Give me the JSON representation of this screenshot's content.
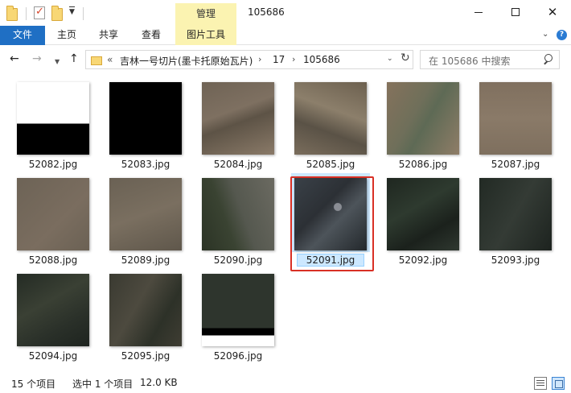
{
  "window": {
    "title": "105686",
    "contextual_tab": "管理"
  },
  "ribbon": {
    "file_tab": "文件",
    "tabs": [
      {
        "label": "主页"
      },
      {
        "label": "共享"
      },
      {
        "label": "查看"
      },
      {
        "label": "图片工具"
      }
    ],
    "active_tab_index": 3
  },
  "address": {
    "overflow": "«",
    "segments": [
      "吉林一号切片(墨卡托原始瓦片)",
      "17",
      "105686"
    ]
  },
  "search": {
    "placeholder": "在 105686 中搜索"
  },
  "files": [
    {
      "name": "52082.jpg",
      "look": "whiteblack"
    },
    {
      "name": "52083.jpg",
      "look": "black"
    },
    {
      "name": "52084.jpg",
      "look": "desert1"
    },
    {
      "name": "52085.jpg",
      "look": "desert2"
    },
    {
      "name": "52086.jpg",
      "look": "desert3"
    },
    {
      "name": "52087.jpg",
      "look": "desert4"
    },
    {
      "name": "52088.jpg",
      "look": "desert5"
    },
    {
      "name": "52089.jpg",
      "look": "desert6"
    },
    {
      "name": "52090.jpg",
      "look": "river"
    },
    {
      "name": "52091.jpg",
      "look": "city",
      "selected": true
    },
    {
      "name": "52092.jpg",
      "look": "forest1"
    },
    {
      "name": "52093.jpg",
      "look": "forest2"
    },
    {
      "name": "52094.jpg",
      "look": "forest3"
    },
    {
      "name": "52095.jpg",
      "look": "hills"
    },
    {
      "name": "52096.jpg",
      "look": "partial"
    }
  ],
  "status": {
    "item_count": "15 个项目",
    "selection": "选中 1 个项目",
    "size": "12.0 KB"
  },
  "colors": {
    "accent": "#1f6fc4",
    "contextual": "#fbf3b1",
    "selection": "#cce8ff",
    "highlight_frame": "#d93025"
  }
}
